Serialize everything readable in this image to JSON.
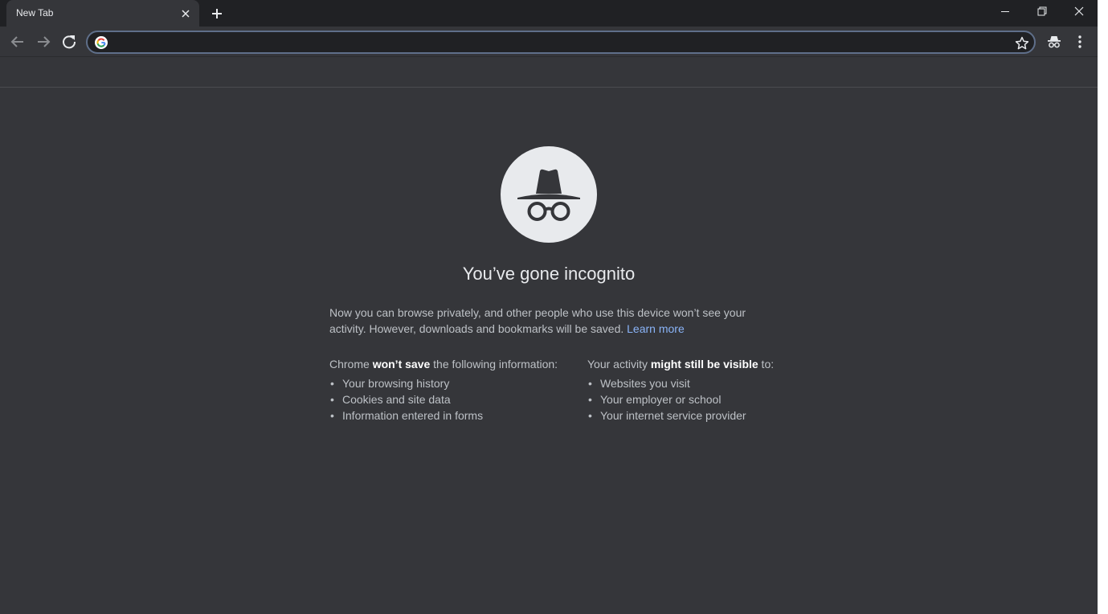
{
  "tab": {
    "title": "New Tab"
  },
  "omnibox": {
    "value": ""
  },
  "page": {
    "heading": "You’ve gone incognito",
    "intro": "Now you can browse privately, and other people who use this device won’t see your activity. However, downloads and bookmarks will be saved.",
    "learn_more": "Learn more",
    "left": {
      "head_pre": "Chrome ",
      "head_bold": "won’t save",
      "head_post": " the following information:",
      "items": [
        "Your browsing history",
        "Cookies and site data",
        "Information entered in forms"
      ]
    },
    "right": {
      "head_pre": "Your activity ",
      "head_bold": "might still be visible",
      "head_post": " to:",
      "items": [
        "Websites you visit",
        "Your employer or school",
        "Your internet service provider"
      ]
    }
  },
  "icons": {
    "tab_close": "close-icon",
    "new_tab": "plus-icon",
    "minimize": "minimize-icon",
    "maximize": "restore-icon",
    "close": "close-icon",
    "back": "arrow-left-icon",
    "forward": "arrow-right-icon",
    "reload": "reload-icon",
    "google": "google-g-icon",
    "star": "star-icon",
    "incognito": "incognito-icon",
    "menu": "kebab-menu-icon"
  },
  "colors": {
    "frame": "#202124",
    "toolbar": "#35363a",
    "page_bg": "#35363a",
    "text": "#bdc1c6",
    "heading": "#e8eaed",
    "link": "#8ab4f8",
    "omnibox_border": "#5f6f8a"
  }
}
